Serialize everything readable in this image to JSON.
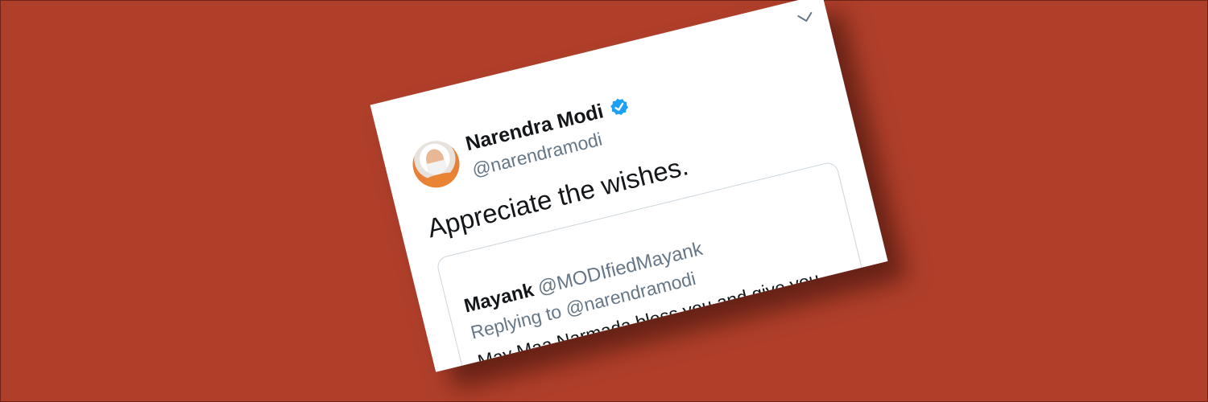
{
  "tweet": {
    "author_name": "Narendra Modi",
    "author_handle": "@narendramodi",
    "text": "Appreciate the wishes.",
    "icons": {
      "verified": "verified-badge-icon",
      "menu": "chevron-down-icon"
    },
    "colors": {
      "verified_blue": "#1da1f2",
      "secondary_text": "#657786",
      "background": "#b03f2a"
    }
  },
  "quoted_tweet": {
    "author_name": "Mayank",
    "author_handle": "@MODIfiedMayank",
    "replying_to": "Replying to @narendramodi",
    "text": "May Maa Narmada bless you and give you more power to clean & rejuvenate her!",
    "icons": {
      "emoji": "folded-hands-icon"
    }
  }
}
